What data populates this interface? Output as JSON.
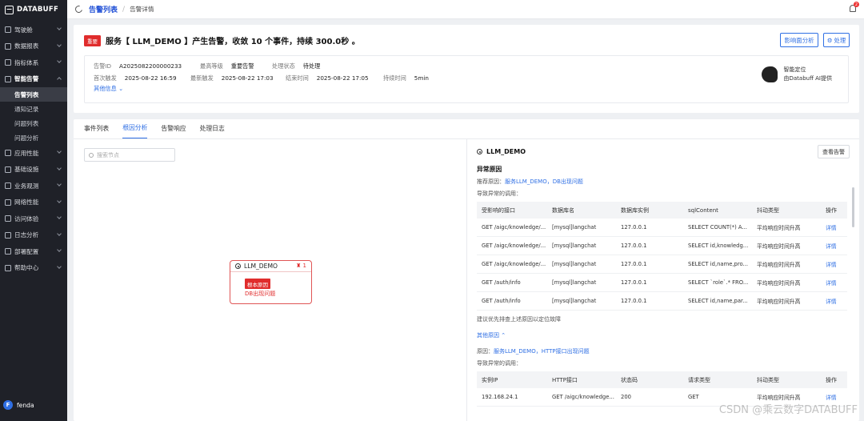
{
  "sidebar": {
    "logo": "DATABUFF",
    "items": [
      {
        "label": "驾驶舱",
        "open": false
      },
      {
        "label": "数据报表",
        "open": false
      },
      {
        "label": "指标体系",
        "open": false
      },
      {
        "label": "智能告警",
        "open": true
      },
      {
        "label": "应用性能",
        "open": false
      },
      {
        "label": "基础设施",
        "open": false
      },
      {
        "label": "业务观测",
        "open": false
      },
      {
        "label": "网络性能",
        "open": false
      },
      {
        "label": "访问体验",
        "open": false
      },
      {
        "label": "日志分析",
        "open": false
      },
      {
        "label": "部署配置",
        "open": false
      },
      {
        "label": "帮助中心",
        "open": false
      }
    ],
    "sub_items": [
      "告警列表",
      "通知记录",
      "问题列表",
      "问题分析"
    ],
    "user": {
      "initial": "F",
      "name": "fenda"
    }
  },
  "topbar": {
    "breadcrumb_main": "告警列表",
    "breadcrumb_sep": "/",
    "breadcrumb_sub": "告警详情",
    "notification_count": "2"
  },
  "alert": {
    "severity_tag": "重要",
    "title": "服务【 LLM_DEMO 】产生告警，收敛 10 个事件，持续 300.0秒 。",
    "btn_impact": "影响面分析",
    "btn_handle": "处理",
    "fields": {
      "id_label": "告警ID",
      "id_value": "A2025082200000233",
      "level_label": "最高等级",
      "level_value": "重要告警",
      "status_label": "处理状态",
      "status_value": "待处理",
      "first_label": "首次触发",
      "first_value": "2025-08-22 16:59",
      "latest_label": "最新触发",
      "latest_value": "2025-08-22 17:03",
      "end_label": "结束时间",
      "end_value": "2025-08-22 17:05",
      "duration_label": "持续时间",
      "duration_value": "5min"
    },
    "more_info": "其他信息",
    "ai_line1": "智能定位",
    "ai_line2": "由Databuff AI提供"
  },
  "tabs": [
    {
      "label": "事件列表",
      "active": false
    },
    {
      "label": "根因分析",
      "active": true
    },
    {
      "label": "告警响应",
      "active": false
    },
    {
      "label": "处理日志",
      "active": false
    }
  ],
  "graph": {
    "search_placeholder": "搜索节点",
    "node_name": "LLM_DEMO",
    "node_count": "1",
    "root_tag": "根本原因",
    "node_desc": "DB出现问题"
  },
  "panel": {
    "title": "LLM_DEMO",
    "view_alert": "查看告警",
    "abnormal_title": "异常原因",
    "recommend_prefix": "推荐原因：",
    "recommend_link": "服务LLM_DEMO，DB出现问题",
    "calls_label": "导致异常的调用：",
    "db_table": {
      "headers": [
        "受影响的接口",
        "数据库名",
        "数据库实例",
        "sqlContent",
        "抖动类型",
        "操作"
      ],
      "rows": [
        [
          "GET /aigc/knowledge/...",
          "[mysql]langchat",
          "127.0.0.1",
          "SELECT COUNT(*) A...",
          "平均响应时间升高",
          "详情"
        ],
        [
          "GET /aigc/knowledge/...",
          "[mysql]langchat",
          "127.0.0.1",
          "SELECT id,knowledg...",
          "平均响应时间升高",
          "详情"
        ],
        [
          "GET /aigc/knowledge/...",
          "[mysql]langchat",
          "127.0.0.1",
          "SELECT id,name,pro...",
          "平均响应时间升高",
          "详情"
        ],
        [
          "GET /auth/info",
          "[mysql]langchat",
          "127.0.0.1",
          "SELECT `role`.* FRO...",
          "平均响应时间升高",
          "详情"
        ],
        [
          "GET /auth/info",
          "[mysql]langchat",
          "127.0.0.1",
          "SELECT id,name,par...",
          "平均响应时间升高",
          "详情"
        ]
      ]
    },
    "suggest": "建议优先排查上述原因以定位故障",
    "other_title": "其他原因",
    "other_prefix": "原因：",
    "other_link": "服务LLM_DEMO，HTTP接口出现问题",
    "calls_label2": "导致异常的调用：",
    "http_table": {
      "headers": [
        "实例IP",
        "HTTP接口",
        "状态码",
        "请求类型",
        "抖动类型",
        "操作"
      ],
      "rows": [
        [
          "192.168.24.1",
          "GET /aigc/knowledge...",
          "200",
          "GET",
          "平均响应时间升高",
          "详情"
        ]
      ]
    }
  },
  "watermark": "CSDN @乘云数字DATABUFF"
}
